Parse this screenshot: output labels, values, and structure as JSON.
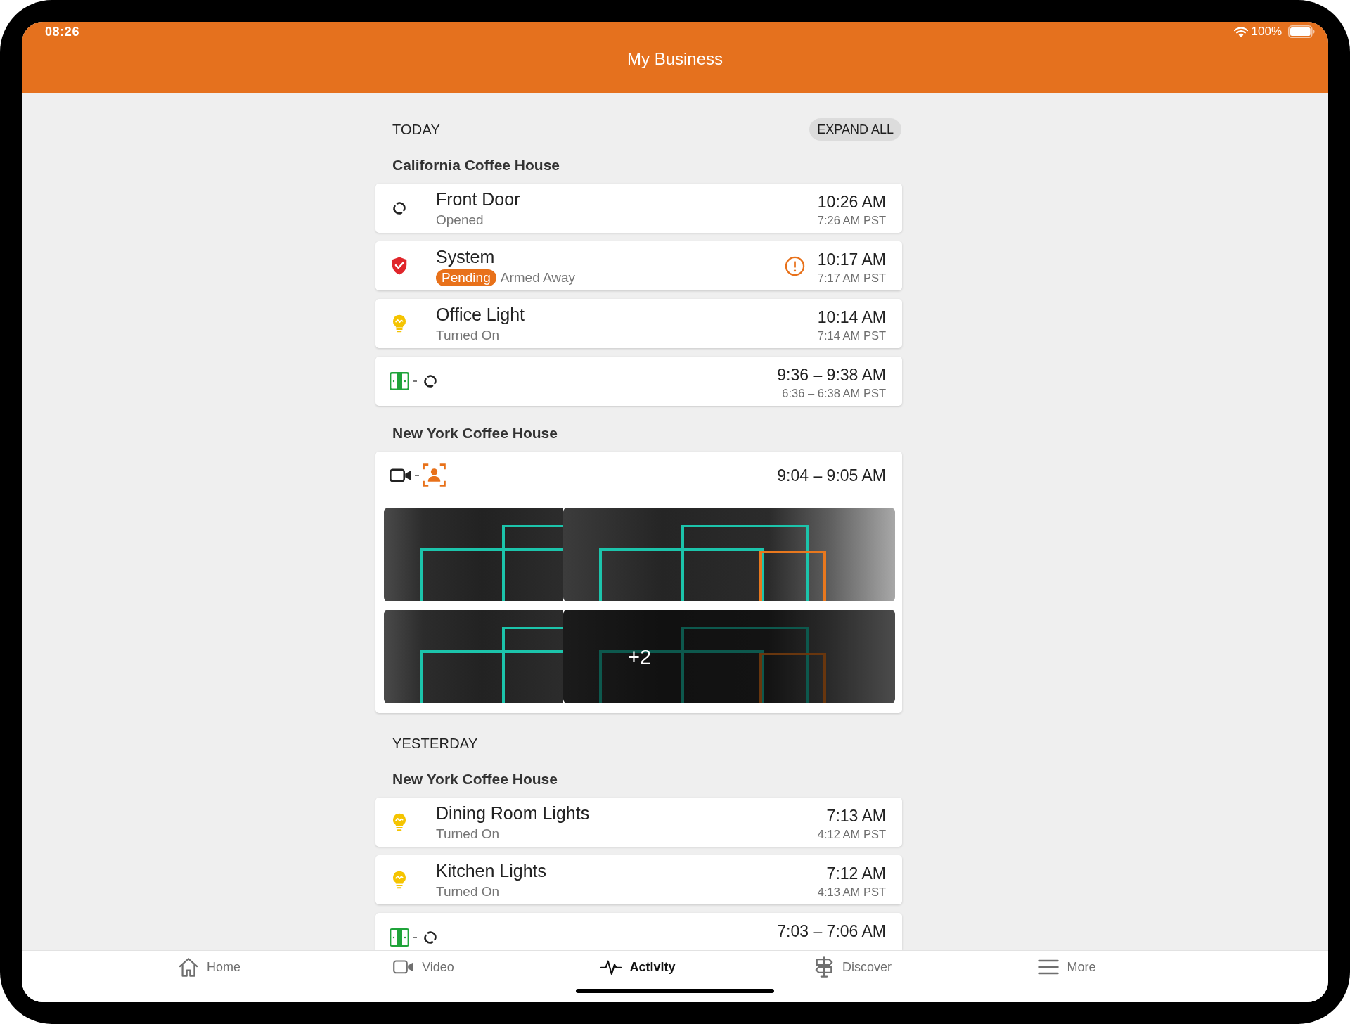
{
  "status_bar": {
    "time": "08:26",
    "battery": "100%"
  },
  "header": {
    "title": "My Business"
  },
  "sections": [
    {
      "day": "TODAY",
      "expand_button": "EXPAND ALL",
      "groups": [
        {
          "location": "California Coffee House",
          "events": [
            {
              "kind": "contact",
              "title": "Front Door",
              "detail": "Opened",
              "alert": false,
              "time": "10:26 AM",
              "local_time": "7:26 AM PST"
            },
            {
              "kind": "security",
              "title": "System",
              "badge": "Pending",
              "detail": "Armed Away",
              "alert": true,
              "time": "10:17 AM",
              "local_time": "7:17 AM PST"
            },
            {
              "kind": "light",
              "title": "Office Light",
              "detail": "Turned On",
              "alert": false,
              "time": "10:14 AM",
              "local_time": "7:14 AM PST"
            },
            {
              "kind": "combo",
              "alert": false,
              "time": "9:36 – 9:38 AM",
              "local_time": "6:36 – 6:38 AM PST"
            }
          ]
        },
        {
          "location": "New York Coffee House",
          "events": [
            {
              "kind": "video",
              "alert": false,
              "time": "9:04 – 9:05 AM",
              "more_count": "+2"
            }
          ]
        }
      ]
    },
    {
      "day": "YESTERDAY",
      "groups": [
        {
          "location": "New York Coffee House",
          "events": [
            {
              "kind": "light",
              "title": "Dining Room Lights",
              "detail": "Turned On",
              "alert": false,
              "time": "7:13 AM",
              "local_time": "4:12 AM PST"
            },
            {
              "kind": "light",
              "title": "Kitchen Lights",
              "detail": "Turned On",
              "alert": false,
              "time": "7:12 AM",
              "local_time": "4:13 AM PST"
            },
            {
              "kind": "combo",
              "alert": false,
              "time": "7:03 – 7:06 AM"
            }
          ]
        }
      ]
    }
  ],
  "tabs": [
    {
      "label": "Home",
      "selected": false
    },
    {
      "label": "Video",
      "selected": false
    },
    {
      "label": "Activity",
      "selected": true
    },
    {
      "label": "Discover",
      "selected": false
    },
    {
      "label": "More",
      "selected": false
    }
  ]
}
